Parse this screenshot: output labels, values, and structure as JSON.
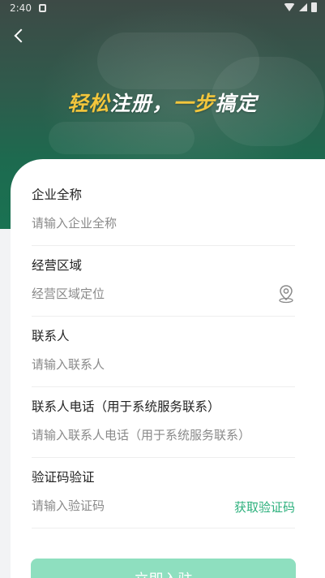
{
  "status_bar": {
    "time": "2:40"
  },
  "header": {
    "title_part1": "轻松",
    "title_part2": "注册，",
    "title_part3": "一步",
    "title_part4": "搞定",
    "accent_color": "#f3c63c"
  },
  "form": {
    "company": {
      "label": "企业全称",
      "placeholder": "请输入企业全称"
    },
    "region": {
      "label": "经营区域",
      "placeholder": "经营区域定位",
      "icon": "location-pin-icon"
    },
    "contact": {
      "label": "联系人",
      "placeholder": "请输入联系人"
    },
    "phone": {
      "label": "联系人电话（用于系统服务联系）",
      "placeholder": "请输入联系人电话（用于系统服务联系）"
    },
    "code": {
      "label": "验证码验证",
      "placeholder": "请输入验证码",
      "link": "获取验证码"
    },
    "submit_label": "立即入驻",
    "brand_color": "#2cb07c"
  }
}
